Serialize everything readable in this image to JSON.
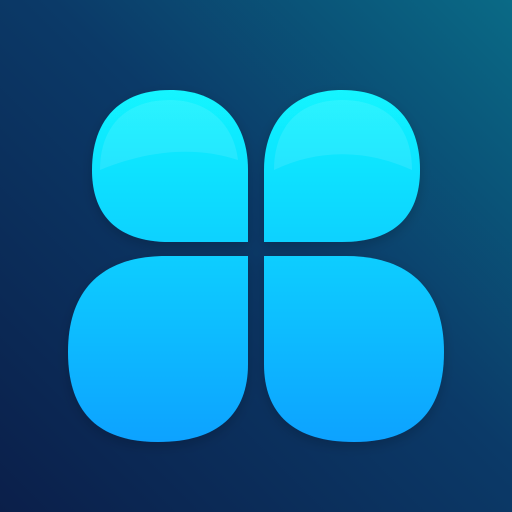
{
  "icon": {
    "name": "four-lobe-clover-icon",
    "colors": {
      "background_top_right": "#0a6a86",
      "background_mid": "#0b3a68",
      "background_bottom_left": "#0b1f4a",
      "petal_top": "#12f6ff",
      "petal_bottom": "#0aa2ff"
    }
  }
}
